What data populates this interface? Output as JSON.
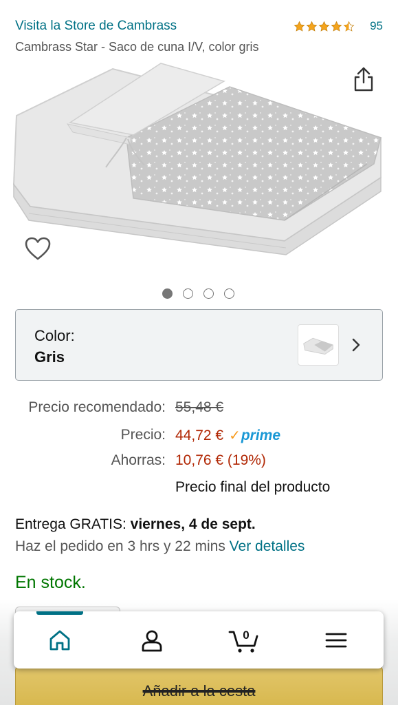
{
  "header": {
    "store_link": "Visita la Store de Cambrass",
    "rating_stars": 4.5,
    "rating_count": "95",
    "product_title": "Cambrass Star - Saco de cuna I/V, color gris"
  },
  "gallery": {
    "image_count": 4,
    "active_index": 0,
    "share_icon": "share-icon",
    "wishlist_icon": "heart-icon"
  },
  "color_selector": {
    "label": "Color:",
    "value": "Gris"
  },
  "pricing": {
    "recommended_label": "Precio recomendado:",
    "recommended_value": "55,48 €",
    "price_label": "Precio:",
    "price_value": "44,72 €",
    "prime_label": "prime",
    "savings_label": "Ahorras:",
    "savings_value": "10,76 € (19%)",
    "final_note": "Precio final del producto"
  },
  "delivery": {
    "prefix": "Entrega GRATIS: ",
    "date": "viernes, 4 de sept.",
    "order_text": "Haz el pedido en 3 hrs y 22 mins ",
    "details_link": "Ver detalles"
  },
  "stock": "En stock.",
  "cart_button": "Añadir a la cesta",
  "bottom_nav": {
    "items": [
      "home-icon",
      "account-icon",
      "cart-icon",
      "menu-icon"
    ],
    "active": "home-icon",
    "cart_count": "0"
  },
  "colors": {
    "link": "#007185",
    "price_red": "#b12704",
    "stock_green": "#007600",
    "prime_blue": "#1a98d5",
    "star_gold": "#f4a41d"
  }
}
